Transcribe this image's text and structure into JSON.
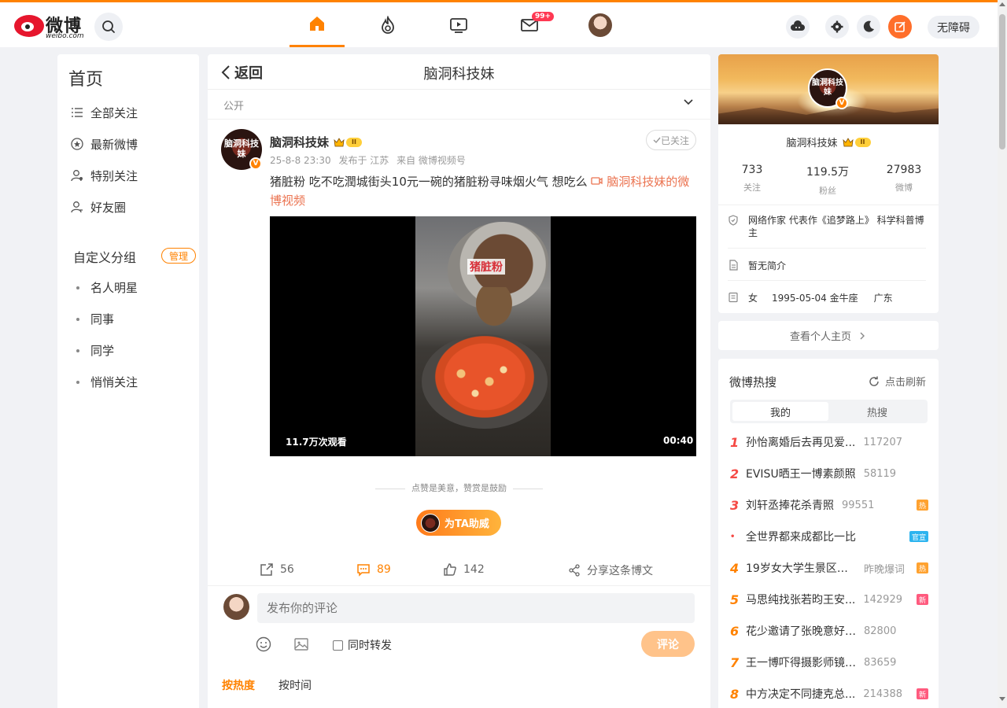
{
  "app": {
    "logo_text": "微博",
    "logo_sub": "weibo.com"
  },
  "topnav": {
    "mail_badge": "99+",
    "accessibility_label": "无障碍",
    "colors": {
      "accent": "#ff8200",
      "compose": "#ff6e2a",
      "badge": "#ff3852"
    }
  },
  "sidebar": {
    "title": "首页",
    "items": [
      {
        "label": "全部关注",
        "icon": "list-icon"
      },
      {
        "label": "最新微博",
        "icon": "star-circle-icon"
      },
      {
        "label": "特别关注",
        "icon": "user-star-icon"
      },
      {
        "label": "好友圈",
        "icon": "user-group-icon"
      }
    ],
    "groups_title": "自定义分组",
    "manage_label": "管理",
    "groups": [
      "名人明星",
      "同事",
      "同学",
      "悄悄关注"
    ]
  },
  "detail": {
    "back_label": "返回",
    "title": "脑洞科技妹",
    "visibility": "公开"
  },
  "post": {
    "author": "脑洞科技妹",
    "avatar_text": "脑洞科技妹",
    "level": "II",
    "verified_mark": "V",
    "time": "25-8-8 23:30",
    "location": "发布于 江苏",
    "source": "来自 微博视频号",
    "follow_label": "已关注",
    "text": "猪脏粉 吃不吃潤城街头10元一碗的猪脏粉寻味烟火气 想吃么",
    "video_link": "脑洞科技妹的微博视频",
    "video": {
      "caption": "猪脏粉",
      "views": "11.7万次观看",
      "duration": "00:40"
    },
    "reward_hint": "点赞是美意，赞赏是鼓励",
    "cheer_label": "为TA助威",
    "reposts": "56",
    "comments": "89",
    "likes": "142",
    "share_label": "分享这条博文"
  },
  "comment_box": {
    "placeholder": "发布你的评论",
    "repost_label": "同时转发",
    "submit_label": "评论",
    "sort_hot": "按热度",
    "sort_time": "按时间"
  },
  "profile": {
    "name": "脑洞科技妹",
    "avatar_text": "脑洞科技妹",
    "level": "II",
    "stats": [
      {
        "num": "733",
        "label": "关注"
      },
      {
        "num": "119.5万",
        "label": "粉丝"
      },
      {
        "num": "27983",
        "label": "微博"
      }
    ],
    "verified_desc": "网络作家 代表作《追梦路上》 科学科普博主",
    "intro": "暂无简介",
    "gender": "女",
    "birthday": "1995-05-04 金牛座",
    "region": "广东",
    "view_home_label": "查看个人主页"
  },
  "hot_search": {
    "title": "微博热搜",
    "refresh_label": "点击刷新",
    "tabs": [
      "我的",
      "热搜"
    ],
    "items": [
      {
        "rank": "1",
        "text": "孙怡离婚后去再见爱...",
        "num": "117207",
        "tag": ""
      },
      {
        "rank": "2",
        "text": "EVISU晒王一博素颜照",
        "num": "58119",
        "tag": ""
      },
      {
        "rank": "3",
        "text": "刘轩丞捧花杀青照",
        "num": "99551",
        "tag": "热"
      },
      {
        "rank": "•",
        "text": "全世界都来成都比一比",
        "num": "",
        "tag": "官宣"
      },
      {
        "rank": "4",
        "text": "19岁女大学生景区内...",
        "num": "昨晚爆词",
        "tag": "热"
      },
      {
        "rank": "5",
        "text": "马思纯找张若昀王安...",
        "num": "142929",
        "tag": "新"
      },
      {
        "rank": "6",
        "text": "花少邀请了张晚意好几次",
        "num": "82800",
        "tag": ""
      },
      {
        "rank": "7",
        "text": "王一博吓得摄影师镜头...",
        "num": "83659",
        "tag": ""
      },
      {
        "rank": "8",
        "text": "中方决定不同捷克总...",
        "num": "214388",
        "tag": "新"
      }
    ],
    "tag_colors": {
      "热": "#ffa230",
      "新": "#ff5a7e",
      "官宣": "#2db4ef"
    }
  }
}
